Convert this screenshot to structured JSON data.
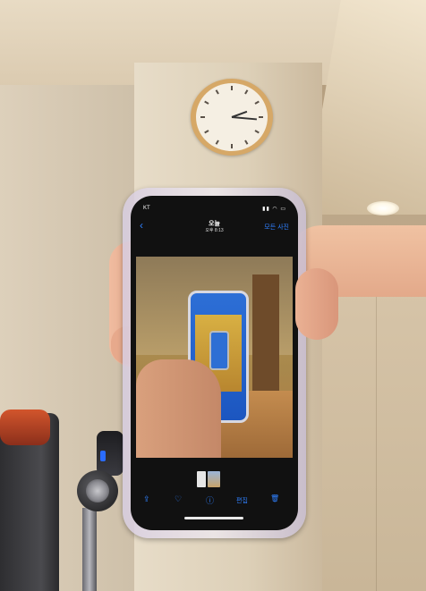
{
  "phone": {
    "carrier": "KT",
    "signal": "▮▮ ◠ ▭",
    "nav_back": "‹",
    "nav_title": "오늘",
    "nav_subtitle": "오후 8:13",
    "nav_all_photos": "모든 사진",
    "toolbar": {
      "share_icon": "⇪",
      "favorite_icon": "♡",
      "info_icon": "ⓘ",
      "edit_label": "편집",
      "trash_icon": "🗑"
    }
  },
  "scene": {
    "background_color": "#b9a58c",
    "clock_rim_color": "#d6a867",
    "phone_accent_color": "#2f80ff"
  }
}
